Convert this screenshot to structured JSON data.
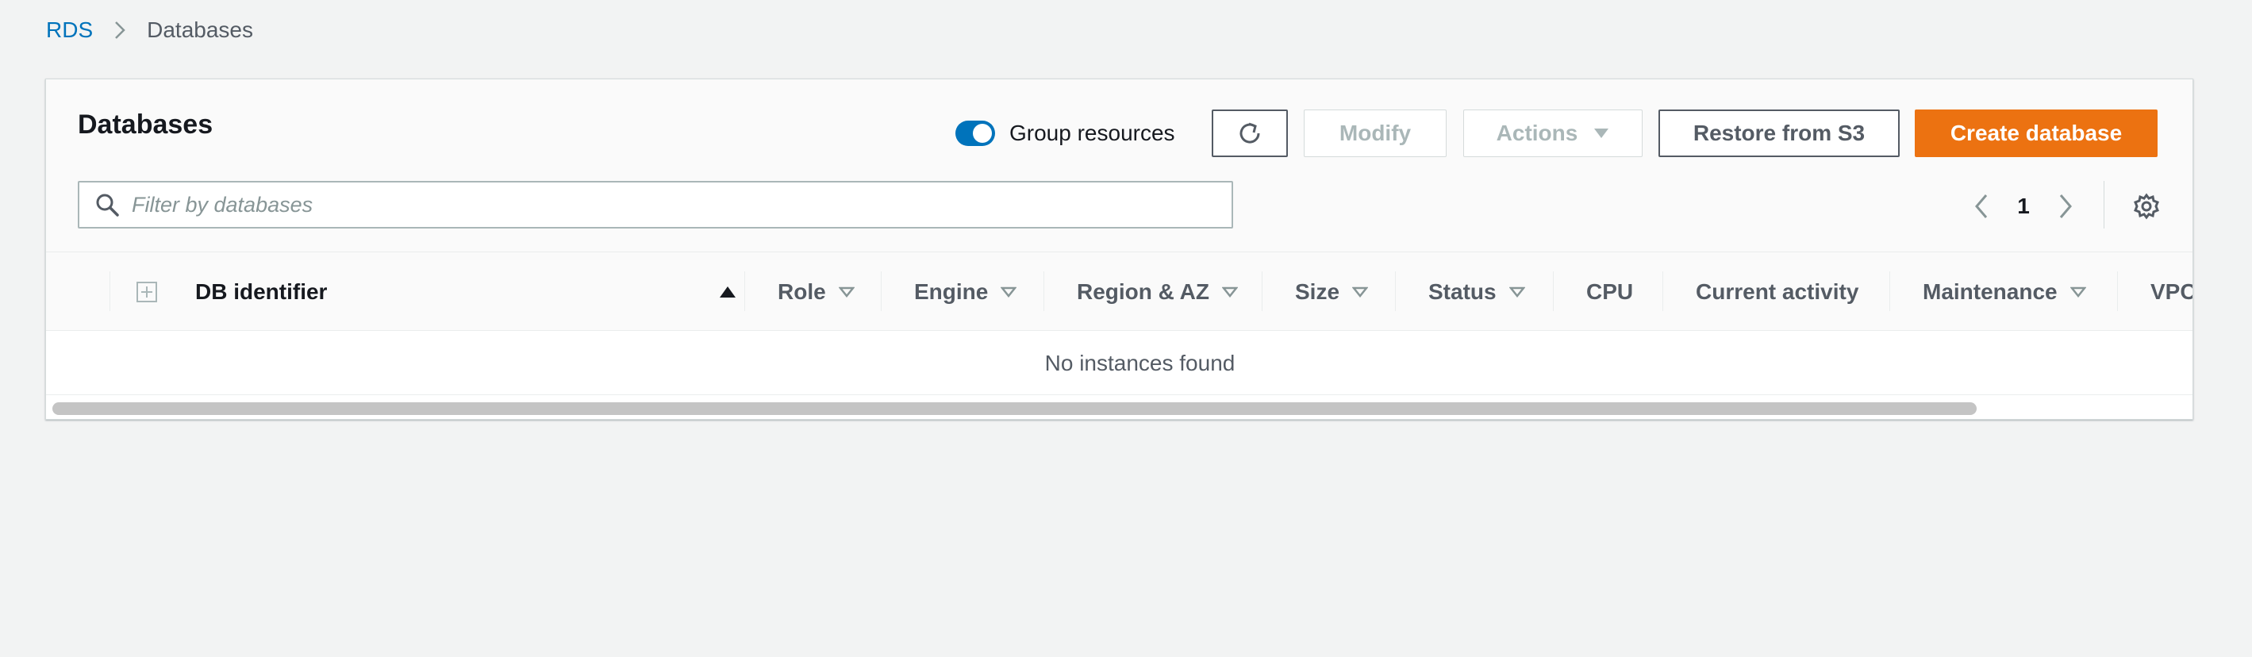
{
  "breadcrumb": {
    "root": "RDS",
    "separator_icon": "chevron-right-icon",
    "current": "Databases"
  },
  "panel": {
    "title": "Databases",
    "group_toggle": {
      "label": "Group resources",
      "enabled": true
    },
    "buttons": {
      "refresh_icon": "refresh-icon",
      "modify": "Modify",
      "actions": "Actions",
      "restore": "Restore from S3",
      "create": "Create database"
    },
    "filter": {
      "placeholder": "Filter by databases",
      "value": ""
    },
    "pagination": {
      "current_page": "1"
    }
  },
  "table": {
    "columns": [
      {
        "label": "DB identifier",
        "sort": "ascending"
      },
      {
        "label": "Role",
        "sort": "sortable"
      },
      {
        "label": "Engine",
        "sort": "sortable"
      },
      {
        "label": "Region & AZ",
        "sort": "sortable"
      },
      {
        "label": "Size",
        "sort": "sortable"
      },
      {
        "label": "Status",
        "sort": "sortable"
      },
      {
        "label": "CPU",
        "sort": "none"
      },
      {
        "label": "Current activity",
        "sort": "none"
      },
      {
        "label": "Maintenance",
        "sort": "sortable"
      },
      {
        "label": "VPC",
        "sort": "none"
      }
    ],
    "empty_message": "No instances found"
  },
  "colors": {
    "accent": "#0073bb",
    "primary_button": "#ec7211",
    "background": "#f2f3f3",
    "text_secondary": "#545b64"
  }
}
